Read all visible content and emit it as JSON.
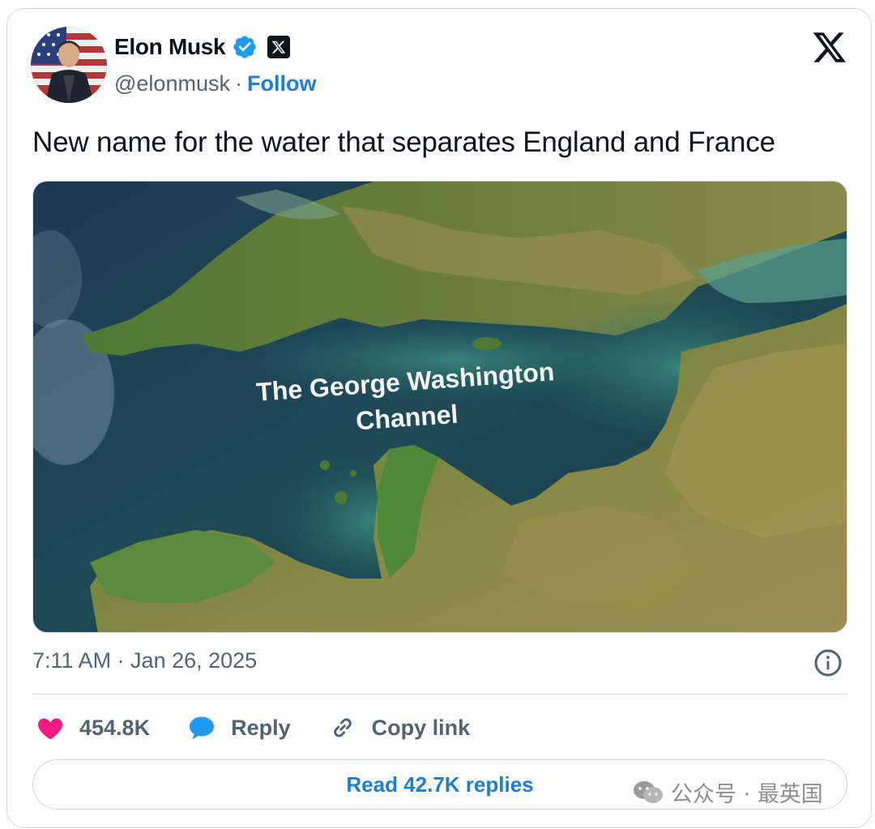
{
  "author": {
    "name": "Elon Musk",
    "handle": "@elonmusk",
    "separator": "·",
    "follow_label": "Follow"
  },
  "tweet": {
    "text": "New name for the water that separates England and France",
    "image_caption_line1": "The George Washington",
    "image_caption_line2": "Channel",
    "timestamp": "7:11 AM · Jan 26, 2025"
  },
  "actions": {
    "likes": "454.8K",
    "reply_label": "Reply",
    "copy_link_label": "Copy link"
  },
  "read_replies_label": "Read 42.7K replies",
  "watermark": "公众号 · 最英国",
  "icons": {
    "verified": "verified-badge-icon",
    "x_affiliation": "x-logo-icon",
    "like": "heart-icon",
    "reply": "speech-bubble-icon",
    "copy": "link-icon",
    "info": "info-icon"
  },
  "colors": {
    "accent": "#1d7fd1",
    "heart": "#f91880",
    "reply_bubble": "#1d9bf0",
    "muted": "#536471"
  }
}
